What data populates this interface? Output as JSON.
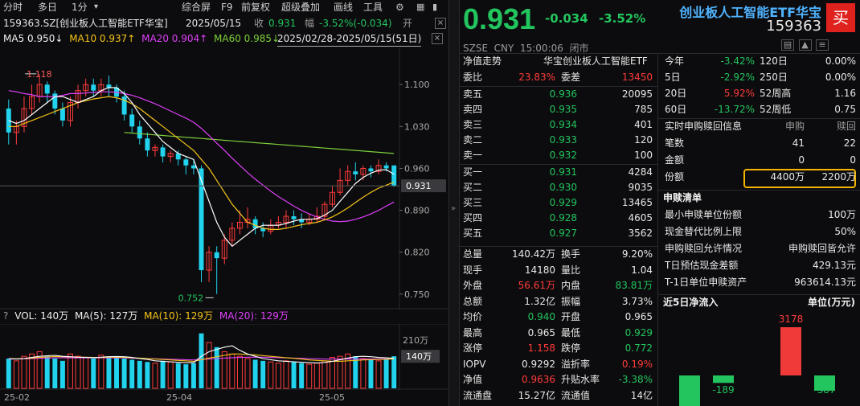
{
  "toolbar": {
    "items": [
      "分时",
      "多日",
      "1分",
      "▾",
      "综合屏",
      "F9",
      "前复权",
      "超级叠加",
      "画线",
      "工具"
    ]
  },
  "chart_header": {
    "title": "159363.SZ[创业板人工智能ETF华宝]",
    "date": "2025/05/15",
    "close_label": "收",
    "close_value": "0.931",
    "change_label": "幅",
    "change_value": "-3.52%(-0.034)",
    "open_label": "开"
  },
  "ma_line": {
    "ma5": "MA5 0.950↓",
    "ma10": "MA10 0.937↑",
    "ma20": "MA20 0.904↑",
    "ma60": "MA60 0.985↓",
    "range": "2025/02/28-2025/05/15(51日)"
  },
  "price_axis": {
    "ticks": [
      "1.100",
      "1.030",
      "0.960",
      "0.890",
      "0.820",
      "0.750"
    ],
    "current": "0.931",
    "high_mark": "1.118",
    "low_mark": "0.752"
  },
  "volume": {
    "legend_vol": "VOL: 140万",
    "legend_ma5": "MA(5): 127万",
    "legend_ma10": "MA(10): 129万",
    "legend_ma20": "MA(20): 129万",
    "axis_top": "210万",
    "current": "140万"
  },
  "date_axis": [
    "25-02",
    "25-04",
    "25-05"
  ],
  "quote": {
    "price": "0.931",
    "change": "-0.034",
    "change_pct": "-3.52%",
    "name": "创业板人工智能ETF华宝",
    "code": "159363",
    "buy_badge": "买",
    "meta": "SZSE  CNY  15:00:06  闭市"
  },
  "orderbook": {
    "nav_label": "净值走势",
    "fund_name": "华宝创业板人工智能ETF",
    "weibi_label": "委比",
    "weibi_value": "23.83%",
    "weicha_label": "委差",
    "weicha_value": "13450",
    "asks": [
      {
        "label": "卖五",
        "price": "0.936",
        "volume": "20095"
      },
      {
        "label": "卖四",
        "price": "0.935",
        "volume": "785"
      },
      {
        "label": "卖三",
        "price": "0.934",
        "volume": "401"
      },
      {
        "label": "卖二",
        "price": "0.933",
        "volume": "120"
      },
      {
        "label": "卖一",
        "price": "0.932",
        "volume": "100"
      }
    ],
    "bids": [
      {
        "label": "买一",
        "price": "0.931",
        "volume": "4284"
      },
      {
        "label": "买二",
        "price": "0.930",
        "volume": "9035"
      },
      {
        "label": "买三",
        "price": "0.929",
        "volume": "13465"
      },
      {
        "label": "买四",
        "price": "0.928",
        "volume": "4605"
      },
      {
        "label": "买五",
        "price": "0.927",
        "volume": "3562"
      }
    ]
  },
  "stats": [
    {
      "l1": "总量",
      "v1": "140.42万",
      "c1": "white",
      "l2": "换手",
      "v2": "9.20%",
      "c2": "white"
    },
    {
      "l1": "现手",
      "v1": "14180",
      "c1": "white",
      "l2": "量比",
      "v2": "1.04",
      "c2": "white"
    },
    {
      "l1": "外盘",
      "v1": "56.61万",
      "c1": "red",
      "l2": "内盘",
      "v2": "83.81万",
      "c2": "green"
    },
    {
      "l1": "总额",
      "v1": "1.32亿",
      "c1": "white",
      "l2": "振幅",
      "v2": "3.73%",
      "c2": "white"
    },
    {
      "l1": "均价",
      "v1": "0.940",
      "c1": "green",
      "l2": "开盘",
      "v2": "0.965",
      "c2": "white"
    },
    {
      "l1": "最高",
      "v1": "0.965",
      "c1": "white",
      "l2": "最低",
      "v2": "0.929",
      "c2": "green"
    },
    {
      "l1": "涨停",
      "v1": "1.158",
      "c1": "red",
      "l2": "跌停",
      "v2": "0.772",
      "c2": "green"
    },
    {
      "l1": "IOPV",
      "v1": "0.9292",
      "c1": "white",
      "l2": "溢折率",
      "v2": "0.19%",
      "c2": "red"
    },
    {
      "l1": "净值",
      "v1": "0.9636",
      "c1": "red",
      "l2": "升贴水率",
      "v2": "-3.38%",
      "c2": "green"
    },
    {
      "l1": "流通盘",
      "v1": "15.27亿",
      "c1": "white",
      "l2": "流通值",
      "v2": "14亿",
      "c2": "white"
    }
  ],
  "performance": [
    {
      "l1": "今年",
      "v1": "-3.42%",
      "c1": "green",
      "l2": "120日",
      "v2": "0.00%"
    },
    {
      "l1": "5日",
      "v1": "-2.92%",
      "c1": "green",
      "l2": "250日",
      "v2": "0.00%"
    },
    {
      "l1": "20日",
      "v1": "5.92%",
      "c1": "red",
      "l2": "52周高",
      "v2": "1.16"
    },
    {
      "l1": "60日",
      "v1": "-13.72%",
      "c1": "green",
      "l2": "52周低",
      "v2": "0.75"
    }
  ],
  "creation": {
    "title": "实时申购赎回信息",
    "col1": "申购",
    "col2": "赎回",
    "rows": [
      {
        "label": "笔数",
        "v1": "41",
        "v2": "22"
      },
      {
        "label": "金额",
        "v1": "0",
        "v2": "0"
      },
      {
        "label": "份额",
        "v1": "4400万",
        "v2": "2200万"
      }
    ]
  },
  "redemption_list": {
    "title": "申赎清单",
    "rows": [
      {
        "label": "最小申赎单位份额",
        "value": "100万"
      },
      {
        "label": "现金替代比例上限",
        "value": "50%"
      },
      {
        "label": "申购赎回允许情况",
        "value": "申购赎回皆允许"
      },
      {
        "label": "T日预估现金差额",
        "value": "429.13元"
      },
      {
        "label": "T-1日单位申赎资产",
        "value": "963614.13元"
      }
    ]
  },
  "flow": {
    "title": "近5日净流入",
    "unit": "单位(万元)",
    "values": [
      -270,
      -189,
      0,
      3178,
      -387
    ],
    "labels": [
      "",
      "-189",
      "",
      "3178",
      "-387"
    ]
  },
  "chart_data": {
    "type": "candlestick",
    "colors": {
      "up": "#ff3b3b",
      "down": "#22d3ee",
      "ma5": "#ffffff",
      "ma10": "#f5c518",
      "ma20": "#e040fb",
      "ma60": "#7ccf3a"
    },
    "ylim": [
      0.735,
      1.15
    ],
    "candles": [
      [
        1.06,
        1.02,
        1.075,
        1.0
      ],
      [
        1.02,
        1.03,
        1.04,
        1.0
      ],
      [
        1.03,
        1.06,
        1.08,
        1.02
      ],
      [
        1.06,
        1.08,
        1.1,
        1.05
      ],
      [
        1.08,
        1.1,
        1.118,
        1.07
      ],
      [
        1.1,
        1.085,
        1.105,
        1.07
      ],
      [
        1.085,
        1.06,
        1.09,
        1.05
      ],
      [
        1.06,
        1.04,
        1.07,
        1.03
      ],
      [
        1.04,
        1.07,
        1.08,
        1.03
      ],
      [
        1.07,
        1.09,
        1.1,
        1.06
      ],
      [
        1.09,
        1.1,
        1.11,
        1.08
      ],
      [
        1.1,
        1.09,
        1.11,
        1.08
      ],
      [
        1.09,
        1.1,
        1.11,
        1.08
      ],
      [
        1.1,
        1.095,
        1.115,
        1.08
      ],
      [
        1.095,
        1.08,
        1.1,
        1.07
      ],
      [
        1.08,
        1.05,
        1.09,
        1.04
      ],
      [
        1.05,
        1.03,
        1.06,
        1.02
      ],
      [
        1.03,
        1.01,
        1.04,
        1.0
      ],
      [
        1.01,
        0.99,
        1.02,
        0.98
      ],
      [
        0.99,
        0.995,
        1.0,
        0.98
      ],
      [
        0.995,
        0.98,
        1.0,
        0.97
      ],
      [
        0.98,
        0.985,
        0.99,
        0.97
      ],
      [
        0.985,
        0.975,
        0.99,
        0.965
      ],
      [
        0.975,
        0.965,
        0.98,
        0.95
      ],
      [
        0.965,
        0.96,
        0.975,
        0.95
      ],
      [
        0.96,
        0.79,
        0.965,
        0.77
      ],
      [
        0.79,
        0.82,
        0.83,
        0.77
      ],
      [
        0.82,
        0.81,
        0.83,
        0.75
      ],
      [
        0.81,
        0.84,
        0.85,
        0.8
      ],
      [
        0.84,
        0.86,
        0.87,
        0.83
      ],
      [
        0.86,
        0.87,
        0.89,
        0.85
      ],
      [
        0.87,
        0.875,
        0.895,
        0.86
      ],
      [
        0.875,
        0.86,
        0.88,
        0.85
      ],
      [
        0.86,
        0.855,
        0.87,
        0.845
      ],
      [
        0.855,
        0.865,
        0.875,
        0.85
      ],
      [
        0.865,
        0.87,
        0.88,
        0.86
      ],
      [
        0.87,
        0.88,
        0.89,
        0.86
      ],
      [
        0.88,
        0.875,
        0.89,
        0.865
      ],
      [
        0.875,
        0.87,
        0.885,
        0.86
      ],
      [
        0.87,
        0.875,
        0.885,
        0.865
      ],
      [
        0.875,
        0.88,
        0.895,
        0.87
      ],
      [
        0.88,
        0.9,
        0.905,
        0.875
      ],
      [
        0.9,
        0.92,
        0.93,
        0.895
      ],
      [
        0.92,
        0.94,
        0.96,
        0.915
      ],
      [
        0.94,
        0.955,
        0.965,
        0.93
      ],
      [
        0.955,
        0.95,
        0.97,
        0.94
      ],
      [
        0.95,
        0.96,
        0.965,
        0.94
      ],
      [
        0.96,
        0.955,
        0.965,
        0.945
      ],
      [
        0.955,
        0.965,
        0.975,
        0.95
      ],
      [
        0.965,
        0.96,
        0.97,
        0.955
      ],
      [
        0.965,
        0.931,
        0.965,
        0.929
      ]
    ],
    "ma5": [
      1.04,
      1.035,
      1.04,
      1.05,
      1.06,
      1.07,
      1.08,
      1.08,
      1.075,
      1.07,
      1.075,
      1.08,
      1.09,
      1.095,
      1.095,
      1.085,
      1.07,
      1.05,
      1.035,
      1.02,
      1.005,
      0.995,
      0.985,
      0.98,
      0.975,
      0.94,
      0.905,
      0.87,
      0.845,
      0.83,
      0.84,
      0.85,
      0.86,
      0.865,
      0.865,
      0.865,
      0.868,
      0.872,
      0.875,
      0.875,
      0.876,
      0.882,
      0.89,
      0.905,
      0.92,
      0.935,
      0.945,
      0.952,
      0.957,
      0.958,
      0.95
    ],
    "ma10": [
      1.03,
      1.03,
      1.035,
      1.04,
      1.045,
      1.05,
      1.055,
      1.06,
      1.065,
      1.07,
      1.073,
      1.076,
      1.078,
      1.08,
      1.078,
      1.074,
      1.068,
      1.06,
      1.05,
      1.04,
      1.03,
      1.02,
      1.01,
      1.0,
      0.99,
      0.975,
      0.96,
      0.94,
      0.92,
      0.9,
      0.885,
      0.87,
      0.865,
      0.86,
      0.858,
      0.858,
      0.86,
      0.863,
      0.866,
      0.868,
      0.87,
      0.874,
      0.879,
      0.886,
      0.894,
      0.903,
      0.912,
      0.92,
      0.927,
      0.932,
      0.937
    ],
    "ma20": [
      1.09,
      1.088,
      1.085,
      1.083,
      1.08,
      1.08,
      1.08,
      1.082,
      1.085,
      1.085,
      1.086,
      1.087,
      1.088,
      1.088,
      1.087,
      1.085,
      1.082,
      1.078,
      1.073,
      1.068,
      1.062,
      1.056,
      1.05,
      1.044,
      1.037,
      1.027,
      1.015,
      1.002,
      0.99,
      0.977,
      0.965,
      0.953,
      0.942,
      0.932,
      0.922,
      0.913,
      0.905,
      0.897,
      0.89,
      0.884,
      0.879,
      0.875,
      0.872,
      0.871,
      0.872,
      0.875,
      0.879,
      0.884,
      0.89,
      0.897,
      0.904
    ],
    "ma60": [
      null,
      null,
      null,
      null,
      null,
      null,
      null,
      null,
      null,
      null,
      null,
      null,
      null,
      null,
      null,
      1.02,
      1.019,
      1.018,
      1.017,
      1.016,
      1.015,
      1.014,
      1.013,
      1.012,
      1.011,
      1.01,
      1.009,
      1.008,
      1.007,
      1.006,
      1.005,
      1.004,
      1.003,
      1.002,
      1.001,
      1.0,
      0.999,
      0.998,
      0.997,
      0.996,
      0.995,
      0.994,
      0.993,
      0.992,
      0.991,
      0.99,
      0.989,
      0.988,
      0.987,
      0.986,
      0.985
    ],
    "volume": [
      130,
      120,
      140,
      150,
      160,
      140,
      130,
      120,
      150,
      140,
      135,
      130,
      145,
      140,
      135,
      130,
      125,
      120,
      115,
      110,
      120,
      115,
      110,
      105,
      110,
      240,
      200,
      180,
      160,
      150,
      140,
      130,
      125,
      120,
      115,
      110,
      120,
      115,
      110,
      105,
      110,
      120,
      135,
      140,
      150,
      140,
      130,
      125,
      120,
      130,
      140
    ],
    "vol_ma5": [
      130,
      128,
      130,
      135,
      140,
      142,
      144,
      140,
      138,
      136,
      135,
      134,
      136,
      138,
      139,
      138,
      135,
      130,
      126,
      120,
      118,
      116,
      114,
      112,
      112,
      140,
      160,
      170,
      180,
      186,
      166,
      150,
      140,
      130,
      125,
      120,
      118,
      116,
      114,
      112,
      111,
      113,
      118,
      125,
      132,
      138,
      140,
      138,
      135,
      133,
      131
    ],
    "vol_ma10": [
      130,
      129,
      130,
      132,
      135,
      137,
      139,
      138,
      137,
      136,
      136,
      135,
      135,
      136,
      136,
      135,
      134,
      132,
      130,
      128,
      126,
      124,
      122,
      120,
      118,
      125,
      132,
      138,
      144,
      150,
      150,
      148,
      146,
      143,
      140,
      137,
      134,
      131,
      128,
      124,
      122,
      120,
      118,
      118,
      120,
      122,
      124,
      125,
      126,
      127,
      129
    ],
    "vol_ma20": [
      128,
      128,
      129,
      130,
      131,
      132,
      133,
      133,
      133,
      133,
      133,
      133,
      133,
      133,
      133,
      133,
      132,
      131,
      130,
      129,
      128,
      127,
      126,
      125,
      124,
      126,
      128,
      130,
      132,
      134,
      135,
      136,
      136,
      136,
      135,
      134,
      133,
      132,
      131,
      130,
      129,
      128,
      128,
      128,
      128,
      128,
      128,
      128,
      129,
      129,
      129
    ],
    "vol_max": 260
  }
}
